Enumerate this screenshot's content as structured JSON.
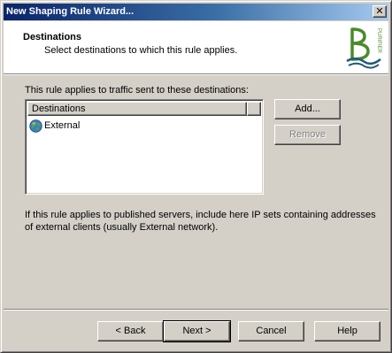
{
  "window": {
    "title": "New Shaping Rule Wizard..."
  },
  "titlebar": {
    "close_glyph": "✕",
    "close_icon": "close-icon"
  },
  "header": {
    "title": "Destinations",
    "subtitle": "Select destinations to which this rule applies.",
    "logo_icon": "wizard-logo",
    "logo_text": "PURIFIER"
  },
  "main": {
    "label": "This rule applies to traffic sent to these destinations:",
    "list": {
      "column": "Destinations",
      "items": [
        {
          "label": "External",
          "icon": "globe-icon"
        }
      ]
    },
    "buttons": {
      "add": "Add...",
      "remove": "Remove"
    },
    "note": "If this rule applies to published servers, include here IP sets containing addresses of external clients (usually External network)."
  },
  "footer": {
    "back": "< Back",
    "next": "Next >",
    "cancel": "Cancel",
    "help": "Help"
  },
  "colors": {
    "title_gradient_start": "#0a246a",
    "title_gradient_end": "#a6caf0",
    "dialog_bg": "#d4d0c8",
    "logo_green": "#4a8a2a"
  }
}
